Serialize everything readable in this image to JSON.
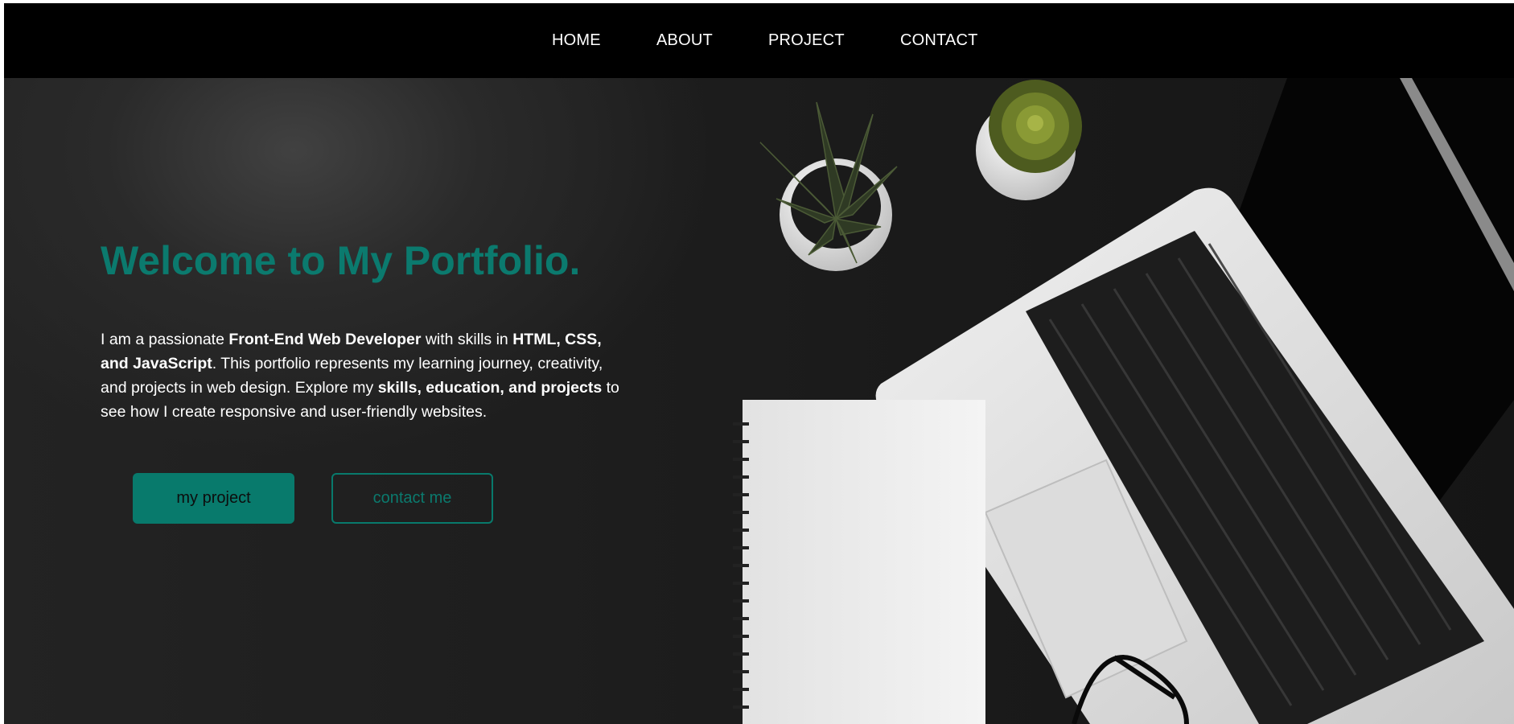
{
  "nav": {
    "items": [
      {
        "label": "HOME"
      },
      {
        "label": "ABOUT"
      },
      {
        "label": "PROJECT"
      },
      {
        "label": "CONTACT"
      }
    ]
  },
  "hero": {
    "title": "Welcome to My Portfolio.",
    "intro": {
      "t1": "I am a passionate ",
      "b1": "Front-End Web Developer",
      "t2": " with skills in ",
      "b2": "HTML, CSS, and JavaScript",
      "t3": ". This portfolio represents my learning journey, creativity, and projects in web design. Explore my ",
      "b3": "skills, education, and projects",
      "t4": " to see how I create responsive and user-friendly websites."
    },
    "buttons": {
      "primary": "my project",
      "secondary": "contact me"
    }
  },
  "colors": {
    "accent": "#087a6c",
    "nav_background": "#000000",
    "hero_background": "#1c1c1c",
    "text": "#ffffff"
  },
  "background_image": {
    "icons": [
      "succulent-plant-icon",
      "laptop-icon",
      "notebook-icon",
      "glasses-icon"
    ]
  }
}
